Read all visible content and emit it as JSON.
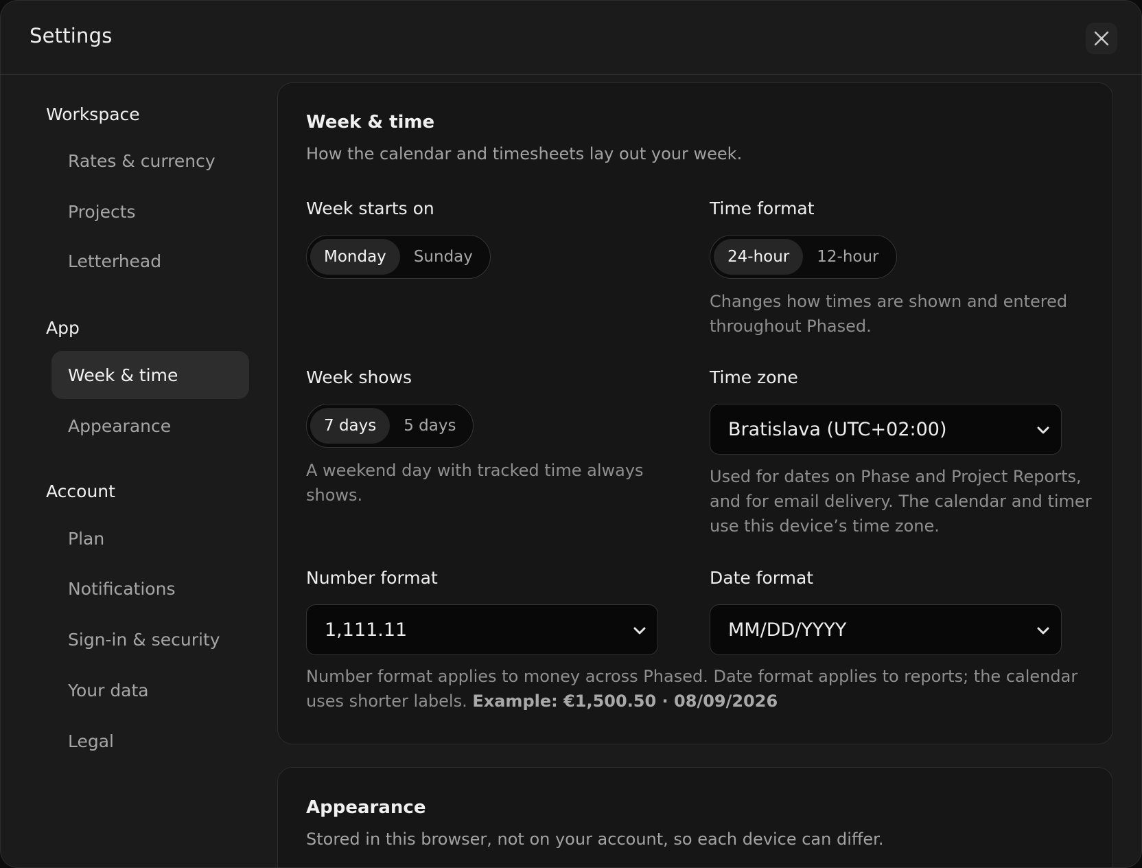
{
  "header": {
    "title": "Settings",
    "close_icon": "close-icon"
  },
  "sidebar": {
    "groups": [
      {
        "title": "Workspace",
        "items": [
          "Rates & currency",
          "Projects",
          "Letterhead"
        ]
      },
      {
        "title": "App",
        "items": [
          "Week & time",
          "Appearance"
        ]
      },
      {
        "title": "Account",
        "items": [
          "Plan",
          "Notifications",
          "Sign-in & security",
          "Your data",
          "Legal"
        ]
      }
    ],
    "active_item": "Week & time"
  },
  "week_time": {
    "title": "Week & time",
    "subtitle": "How the calendar and timesheets lay out your week.",
    "week_starts": {
      "label": "Week starts on",
      "options": [
        "Monday",
        "Sunday"
      ],
      "selected": "Monday"
    },
    "time_format": {
      "label": "Time format",
      "options": [
        "24-hour",
        "12-hour"
      ],
      "selected": "24-hour",
      "help_line1": "Changes how times are shown and entered",
      "help_line2": "throughout Phased."
    },
    "week_shows": {
      "label": "Week shows",
      "options": [
        "7 days",
        "5 days"
      ],
      "selected": "7 days",
      "help_line1": "A weekend day with tracked time always",
      "help_line2": "shows."
    },
    "time_zone": {
      "label": "Time zone",
      "value": "Bratislava (UTC+02:00)",
      "help_line1": "Used for dates on Phase and Project Reports,",
      "help_line2": "and for email delivery. The calendar and timer",
      "help_line3": "use this device’s time zone."
    },
    "number_format": {
      "label": "Number format",
      "value": "1,111.11"
    },
    "date_format": {
      "label": "Date format",
      "value": "MM/DD/YYYY"
    },
    "format_help": {
      "line1": "Number format applies to money across Phased. Date format applies to reports; the calendar",
      "line2_prefix": "uses shorter labels. ",
      "example": "Example: €1,500.50 · 08/09/2026"
    }
  },
  "appearance": {
    "title": "Appearance",
    "subtitle": "Stored in this browser, not on your account, so each device can differ."
  },
  "colors": {
    "background": "#1b1b1b",
    "card": "#161616",
    "active_nav": "#2d2d2d",
    "input": "#080808"
  }
}
